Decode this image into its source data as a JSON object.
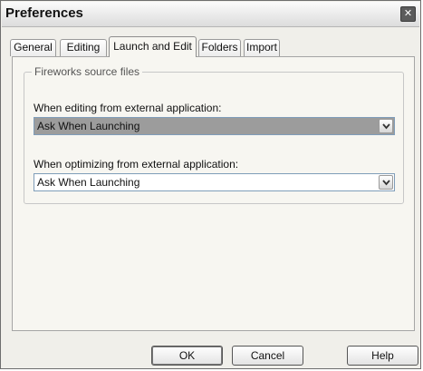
{
  "window": {
    "title": "Preferences",
    "close_glyph": "✕"
  },
  "tabs": [
    {
      "label": "General",
      "active": false
    },
    {
      "label": "Editing",
      "active": false
    },
    {
      "label": "Launch and Edit",
      "active": true
    },
    {
      "label": "Folders",
      "active": false
    },
    {
      "label": "Import",
      "active": false
    }
  ],
  "group": {
    "legend": "Fireworks source files",
    "editing_label": "When editing from external application:",
    "editing_value": "Ask When Launching",
    "optimizing_label": "When optimizing from external application:",
    "optimizing_value": "Ask When Launching"
  },
  "buttons": {
    "ok": "OK",
    "cancel": "Cancel",
    "help": "Help"
  },
  "icons": {
    "close": "close-icon",
    "dropdown": "chevron-down-icon"
  }
}
